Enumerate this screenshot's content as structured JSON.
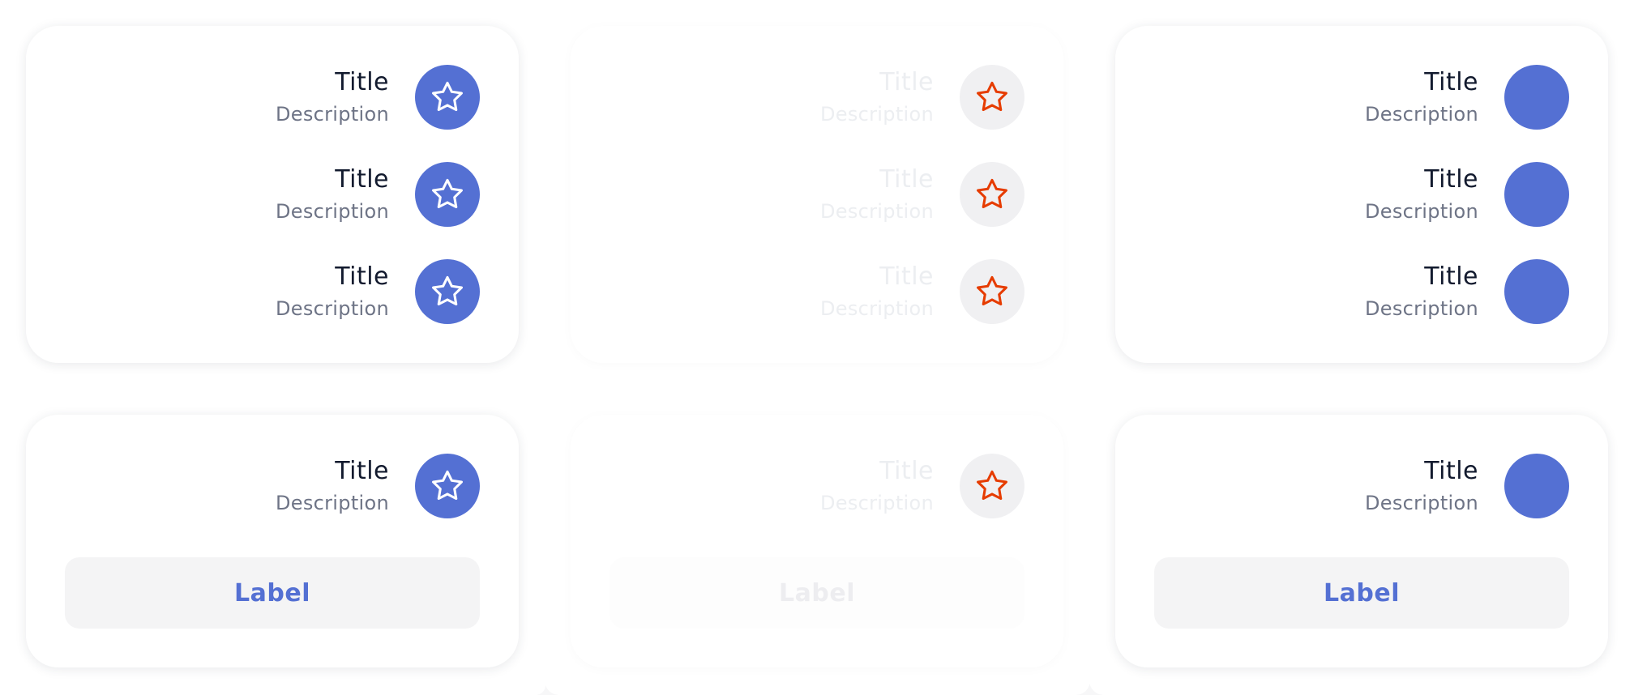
{
  "colors": {
    "accent": "#5470d3",
    "star_disabled": "#e63c00",
    "title_text": "#121a2e",
    "description_text": "#6e7486"
  },
  "cards": [
    {
      "id": "top-left",
      "state": "enabled",
      "items": [
        {
          "title": "Title",
          "description": "Description",
          "icon": "star-icon"
        },
        {
          "title": "Title",
          "description": "Description",
          "icon": "star-icon"
        },
        {
          "title": "Title",
          "description": "Description",
          "icon": "star-icon"
        }
      ]
    },
    {
      "id": "top-middle",
      "state": "disabled",
      "items": [
        {
          "title": "Title",
          "description": "Description",
          "icon": "star-icon"
        },
        {
          "title": "Title",
          "description": "Description",
          "icon": "star-icon"
        },
        {
          "title": "Title",
          "description": "Description",
          "icon": "star-icon"
        }
      ]
    },
    {
      "id": "top-right",
      "state": "enabled",
      "items": [
        {
          "title": "Title",
          "description": "Description",
          "icon": "none"
        },
        {
          "title": "Title",
          "description": "Description",
          "icon": "none"
        },
        {
          "title": "Title",
          "description": "Description",
          "icon": "none"
        }
      ]
    },
    {
      "id": "bottom-left",
      "state": "enabled",
      "items": [
        {
          "title": "Title",
          "description": "Description",
          "icon": "star-icon"
        }
      ],
      "button_label": "Label"
    },
    {
      "id": "bottom-middle",
      "state": "disabled",
      "items": [
        {
          "title": "Title",
          "description": "Description",
          "icon": "star-icon"
        }
      ],
      "button_label": "Label"
    },
    {
      "id": "bottom-right",
      "state": "enabled",
      "items": [
        {
          "title": "Title",
          "description": "Description",
          "icon": "none"
        }
      ],
      "button_label": "Label"
    }
  ]
}
